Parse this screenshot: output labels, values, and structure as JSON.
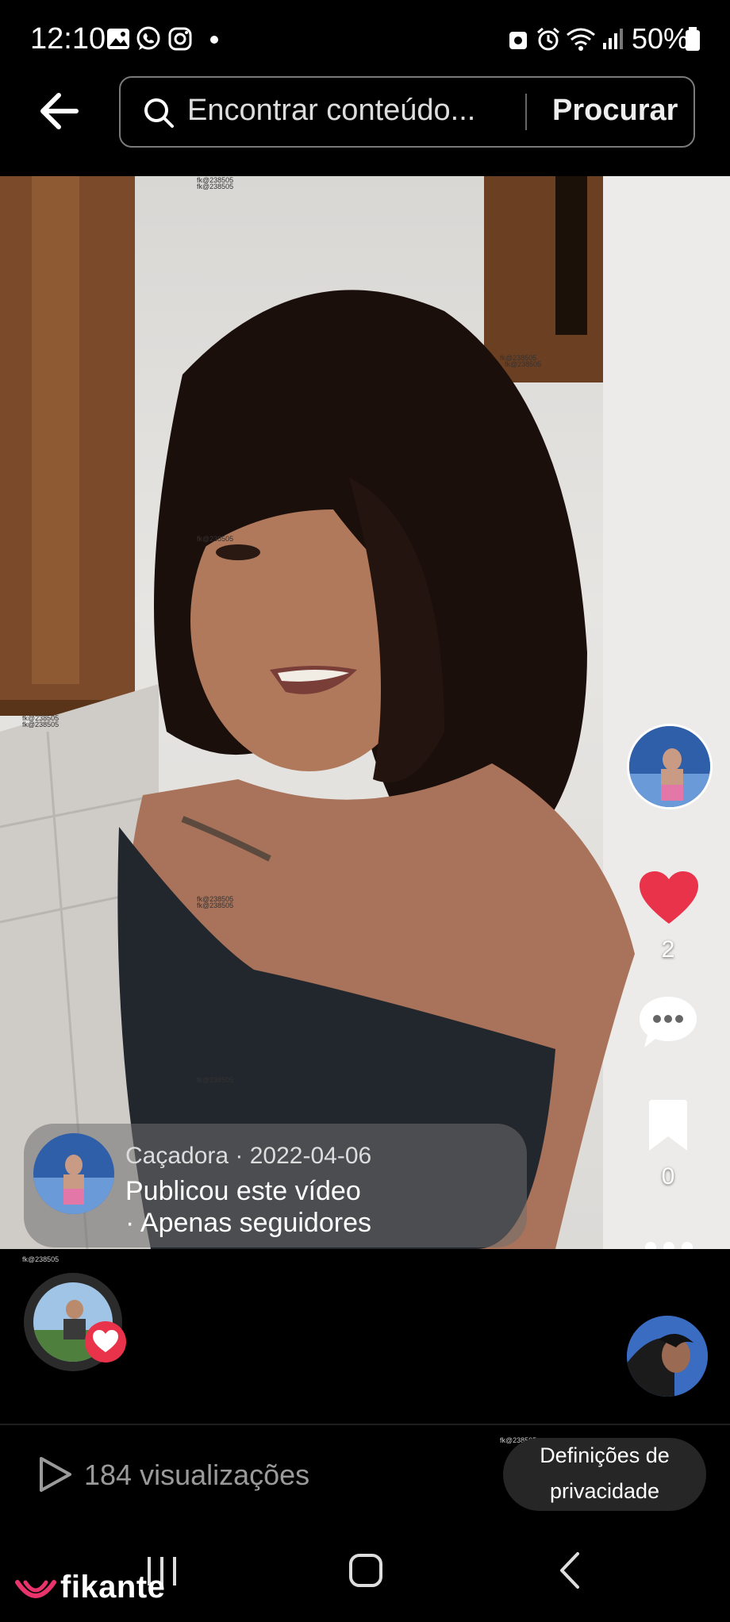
{
  "status_bar": {
    "time": "12:10",
    "battery": "50%",
    "left_icons": [
      "gallery-icon",
      "whatsapp-icon",
      "instagram-icon",
      "notification-dot-icon"
    ],
    "right_icons": [
      "lock-icon",
      "alarm-icon",
      "wifi-icon",
      "signal-icon",
      "battery-icon"
    ]
  },
  "search": {
    "placeholder": "Encontrar conteúdo...",
    "button_label": "Procurar"
  },
  "watermark_text": "fk@238505",
  "video": {
    "likes": "2",
    "bookmarks": "0"
  },
  "publisher": {
    "name_line": "Caçadora · 2022-04-06",
    "action": "Publicou este vídeo",
    "visibility": "· Apenas seguidores"
  },
  "stats": {
    "views": "184 visualizações",
    "privacy_button_line1": "Definições de",
    "privacy_button_line2": "privacidade"
  },
  "brand": {
    "logo": "fikante",
    "accent": "#e8336b",
    "like_color": "#e8334a"
  }
}
